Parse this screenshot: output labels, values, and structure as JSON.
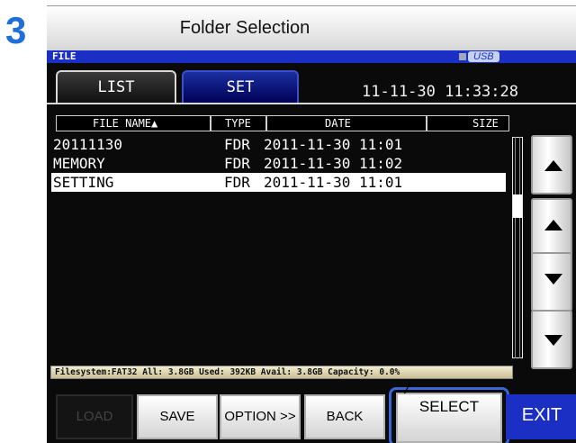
{
  "step": {
    "number": "3"
  },
  "doc_title": "Folder Selection",
  "screen": {
    "title": "FILE",
    "usb_label": "USB",
    "tabs": [
      {
        "label": "LIST"
      },
      {
        "label": "SET"
      }
    ],
    "clock": "11-11-30 11:33:28",
    "columns": {
      "name": "FILE NAME▲",
      "type": "TYPE",
      "date": "DATE",
      "size": "SIZE"
    },
    "rows": [
      {
        "name": "20111130",
        "type": "FDR",
        "date": "2011-11-30 11:01",
        "selected": false
      },
      {
        "name": "MEMORY",
        "type": "FDR",
        "date": "2011-11-30 11:02",
        "selected": false
      },
      {
        "name": "SETTING",
        "type": "FDR",
        "date": "2011-11-30 11:01",
        "selected": true
      }
    ],
    "status": "Filesystem:FAT32 All: 3.8GB Used: 392KB Avail: 3.8GB Capacity: 0.0%",
    "buttons": {
      "load": "LOAD",
      "save": "SAVE",
      "option": "OPTION >>",
      "back": "BACK",
      "select": "SELECT",
      "exit": "EXIT"
    },
    "scroll_buttons": [
      "page-up-icon",
      "line-up-icon",
      "line-down-icon",
      "page-down-icon"
    ],
    "colors": {
      "accent": "#1c2fc4",
      "highlight": "#3b67d6",
      "step": "#1e6fd9"
    }
  }
}
